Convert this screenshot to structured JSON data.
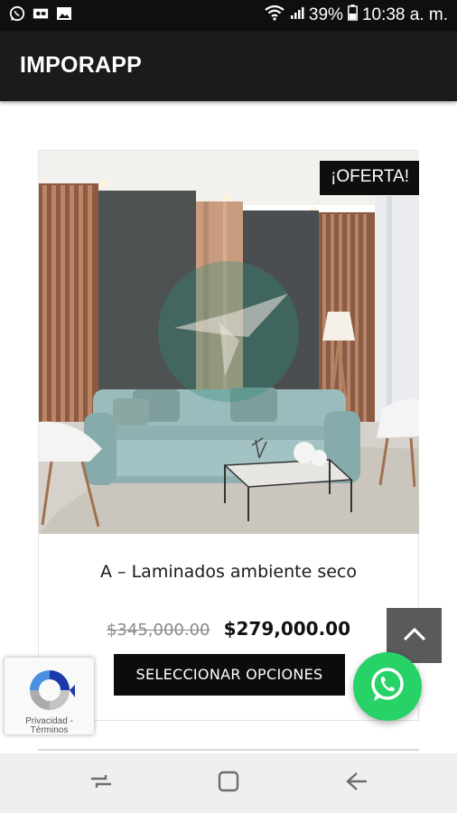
{
  "status_bar": {
    "battery": "39%",
    "time": "10:38 a. m.",
    "left_icons": [
      "whatsapp-icon",
      "screen-record-icon",
      "gallery-icon"
    ],
    "right_icons": [
      "wifi-icon",
      "signal-icon",
      "battery-icon"
    ]
  },
  "app_bar": {
    "title": "IMPORAPP"
  },
  "product": {
    "badge": "¡OFERTA!",
    "title": "A – Laminados ambiente seco",
    "price_old": "$345,000.00",
    "price_new": "$279,000.00",
    "button_label": "SELECCIONAR OPCIONES",
    "image": "living-room-photo"
  },
  "recaptcha": {
    "link1": "Privacidad",
    "separator": "-",
    "link2": "Términos"
  },
  "floating": {
    "back_to_top_icon": "chevron-up-icon",
    "whatsapp_icon": "whatsapp-icon"
  },
  "nav_bar": {
    "buttons": [
      "recent-apps-icon",
      "home-icon",
      "back-icon"
    ]
  }
}
